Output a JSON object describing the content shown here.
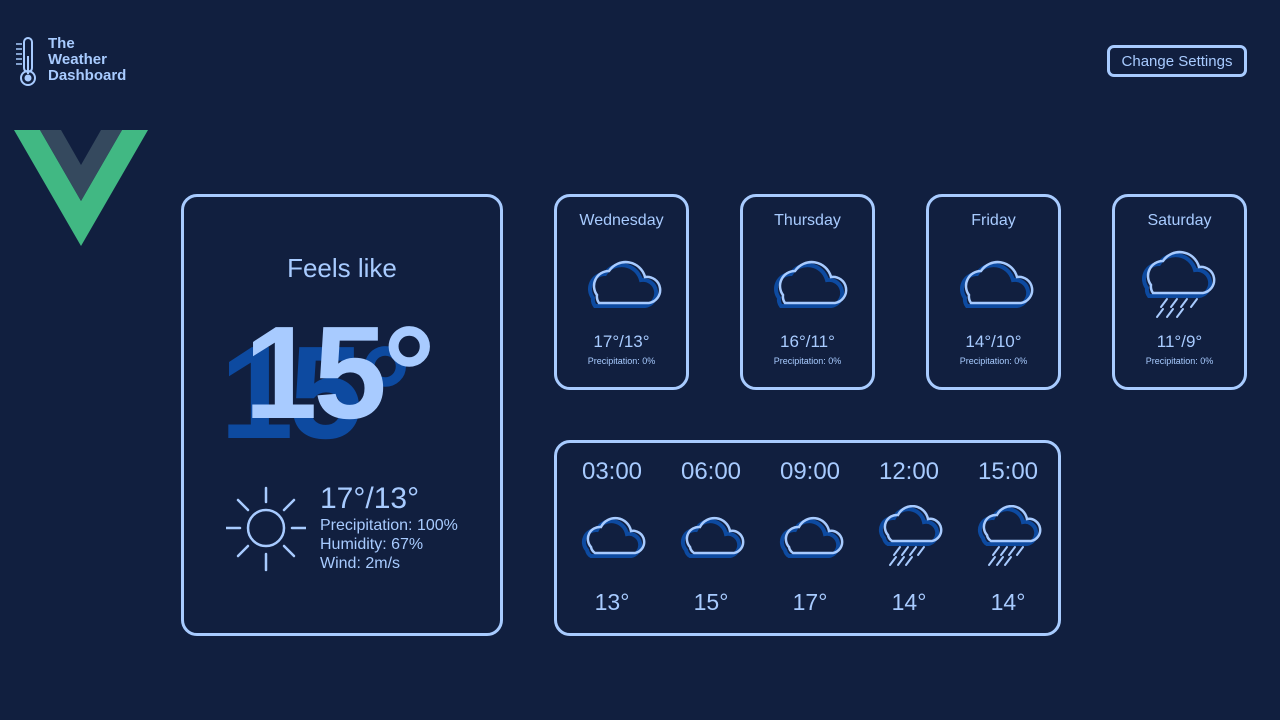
{
  "brand": {
    "line1": "The",
    "line2": "Weather",
    "line3": "Dashboard",
    "icon": "thermometer-icon"
  },
  "header": {
    "settings_label": "Change Settings"
  },
  "colors": {
    "background": "#111f3f",
    "accent": "#a8cbff",
    "shadow": "#0d4aa0",
    "vue_green": "#41b883",
    "vue_dark": "#35495e"
  },
  "current": {
    "feels_label": "Feels like",
    "feels_temp": "15°",
    "range": "17°/13°",
    "precipitation": "Precipitation: 100%",
    "humidity": "Humidity: 67%",
    "wind": "Wind: 2m/s",
    "icon": "sun-icon"
  },
  "daily": [
    {
      "day": "Wednesday",
      "range": "17°/13°",
      "precip": "Precipitation: 0%",
      "icon": "cloud-icon"
    },
    {
      "day": "Thursday",
      "range": "16°/11°",
      "precip": "Precipitation: 0%",
      "icon": "cloud-icon"
    },
    {
      "day": "Friday",
      "range": "14°/10°",
      "precip": "Precipitation: 0%",
      "icon": "cloud-icon"
    },
    {
      "day": "Saturday",
      "range": "11°/9°",
      "precip": "Precipitation: 0%",
      "icon": "rain-cloud-icon"
    }
  ],
  "hourly": [
    {
      "time": "03:00",
      "temp": "13°",
      "icon": "cloud-icon"
    },
    {
      "time": "06:00",
      "temp": "15°",
      "icon": "cloud-icon"
    },
    {
      "time": "09:00",
      "temp": "17°",
      "icon": "cloud-icon"
    },
    {
      "time": "12:00",
      "temp": "14°",
      "icon": "rain-cloud-icon"
    },
    {
      "time": "15:00",
      "temp": "14°",
      "icon": "rain-cloud-icon"
    }
  ]
}
